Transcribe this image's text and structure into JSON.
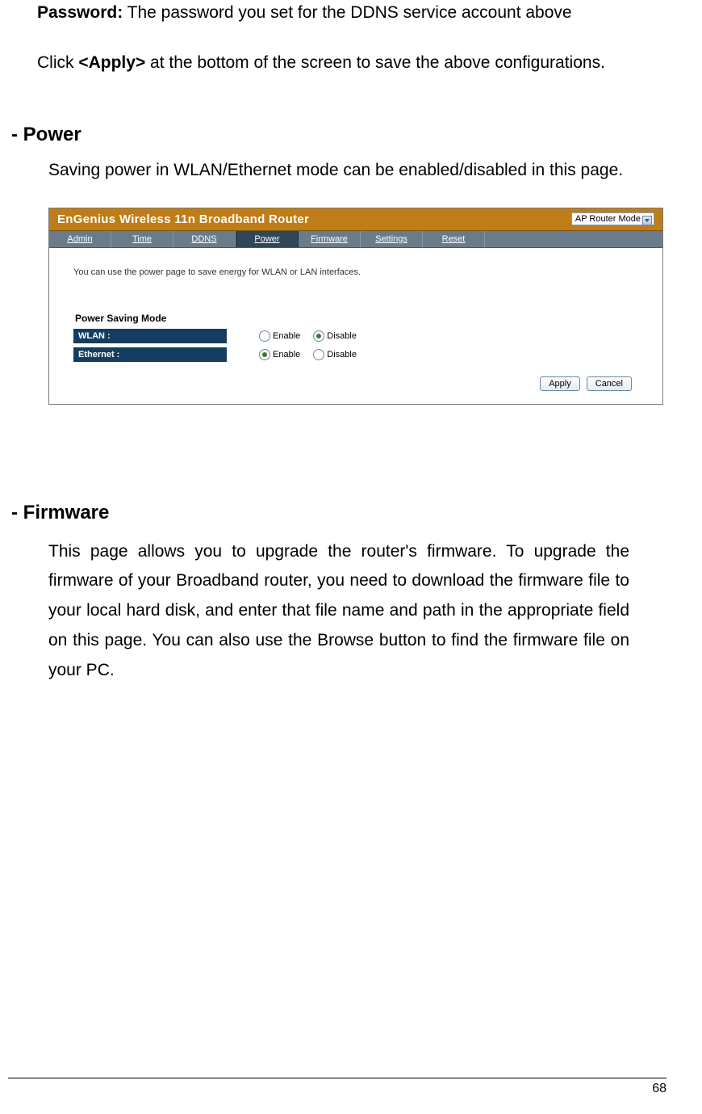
{
  "intro": {
    "password_label": "Password:",
    "password_text": " The password you set for the DDNS service account above",
    "apply_pre": "Click ",
    "apply_bold": "<Apply>",
    "apply_post": " at the bottom of the screen to save the above configurations."
  },
  "power": {
    "heading": "- Power",
    "desc": "Saving power in WLAN/Ethernet mode can be enabled/disabled in this page."
  },
  "screenshot": {
    "title": "EnGenius Wireless 11n Broadband Router",
    "mode": "AP Router Mode",
    "tabs": [
      "Admin",
      "Time",
      "DDNS",
      "Power",
      "Firmware",
      "Settings",
      "Reset"
    ],
    "active_tab": "Power",
    "body_desc": "You can use the power page to save energy for WLAN or LAN interfaces.",
    "section_title": "Power Saving Mode",
    "rows": [
      {
        "label": "WLAN :",
        "enable": "Enable",
        "disable": "Disable",
        "selected": "disable"
      },
      {
        "label": "Ethernet :",
        "enable": "Enable",
        "disable": "Disable",
        "selected": "enable"
      }
    ],
    "buttons": {
      "apply": "Apply",
      "cancel": "Cancel"
    }
  },
  "firmware": {
    "heading": "- Firmware",
    "desc": "This page allows you to upgrade the router's firmware. To upgrade the firmware of your Broadband router, you need to download the firmware file to your local hard disk, and enter that file name and path in the appropriate field on this page. You can also use the Browse button to find the firmware file on your PC."
  },
  "page_number": "68"
}
